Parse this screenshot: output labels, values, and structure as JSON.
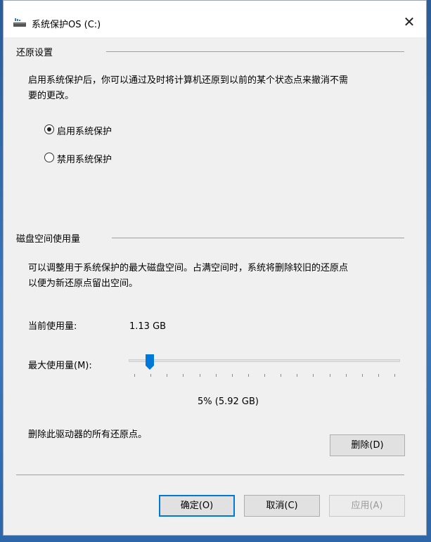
{
  "window": {
    "title": "系统保护OS (C:)",
    "close_symbol": "✕"
  },
  "restore_settings": {
    "group_label": "还原设置",
    "description_line1": "启用系统保护后，你可以通过及时将计算机还原到以前的某个状态点来撤消不需",
    "description_line2": "要的更改。",
    "options": [
      {
        "label": "启用系统保护",
        "selected": true
      },
      {
        "label": "禁用系统保护",
        "selected": false
      }
    ]
  },
  "disk_usage": {
    "group_label": "磁盘空间使用量",
    "description_line1": "可以调整用于系统保护的最大磁盘空间。占满空间时，系统将删除较旧的还原点",
    "description_line2": "以便为新还原点留出空间。",
    "current_label": "当前使用量:",
    "current_value": "1.13 GB",
    "max_label": "最大使用量(M):",
    "slider_percent": 5,
    "slider_readout": "5% (5.92 GB)",
    "delete_text": "删除此驱动器的所有还原点。",
    "delete_button": "删除(D)"
  },
  "footer": {
    "ok": "确定(O)",
    "cancel": "取消(C)",
    "apply": "应用(A)"
  },
  "colors": {
    "accent": "#0078d7",
    "slider_thumb": "#0078d7"
  }
}
